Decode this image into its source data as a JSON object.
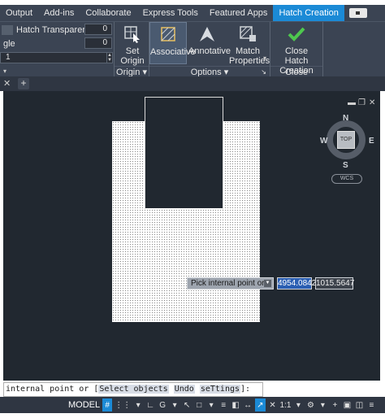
{
  "ribbon_tabs": [
    {
      "label": "Output",
      "active": false
    },
    {
      "label": "Add-ins",
      "active": false
    },
    {
      "label": "Collaborate",
      "active": false
    },
    {
      "label": "Express Tools",
      "active": false
    },
    {
      "label": "Featured Apps",
      "active": false
    },
    {
      "label": "Hatch Creation",
      "active": true
    }
  ],
  "properties": {
    "transparency_label": "Hatch Transparency",
    "transparency_value": "0",
    "angle_label": "gle",
    "angle_value": "0",
    "scale_value": "1"
  },
  "commands": {
    "set_origin": "Set\nOrigin",
    "associative": "Associative",
    "annotative": "Annotative",
    "match_properties": "Match\nProperties",
    "close_hatch": "Close\nHatch Creation"
  },
  "panels": {
    "origin": "Origin",
    "options": "Options",
    "close": "Close"
  },
  "viewcube": {
    "north": "N",
    "south": "S",
    "east": "E",
    "west": "W",
    "top": "TOP",
    "wcs": "WCS"
  },
  "prompt": {
    "text": "Pick internal point or",
    "x": "4954.0842",
    "y": "1015.5647"
  },
  "command_line": {
    "prefix": "internal point or [",
    "opt1": "Select objects",
    "opt2": "Undo",
    "opt3": "seTtings",
    "suffix": "]:"
  },
  "status_bar": {
    "model": "MODEL",
    "scale": "1:1"
  },
  "colors": {
    "ribbon_bg": "#3b4453",
    "accent": "#1b8ad6",
    "canvas_bg": "#212830"
  }
}
